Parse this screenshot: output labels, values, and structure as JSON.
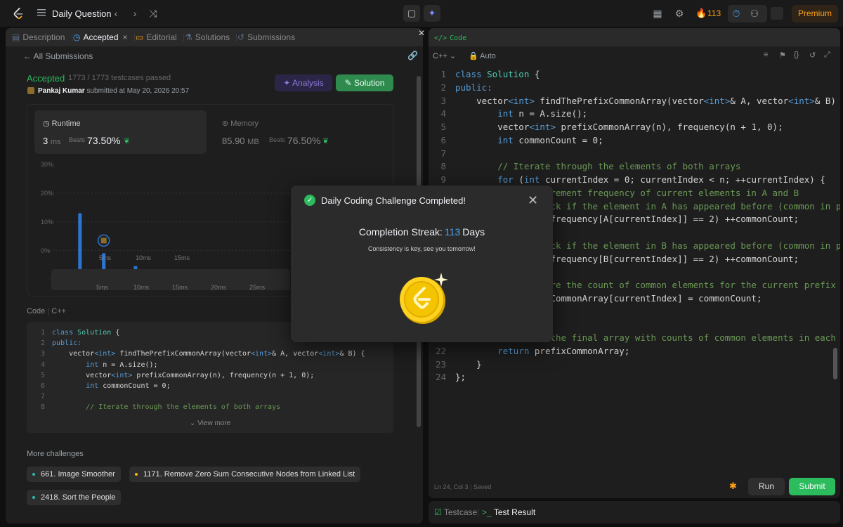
{
  "topbar": {
    "title": "Daily Question",
    "streak_count": "113",
    "premium_label": "Premium"
  },
  "left_tabs": [
    {
      "label": "Description"
    },
    {
      "label": "Accepted"
    },
    {
      "label": "Editorial"
    },
    {
      "label": "Solutions"
    },
    {
      "label": "Submissions"
    }
  ],
  "submission": {
    "back_label": "All Submissions",
    "status": "Accepted",
    "testcases": "1773 / 1773 testcases passed",
    "author": "Pankaj Kumar",
    "submitted_text": "submitted at May 20, 2026 20:57",
    "analysis_label": "Analysis",
    "solution_label": "Solution"
  },
  "stats": {
    "runtime_label": "Runtime",
    "runtime_value": "3",
    "runtime_unit": "ms",
    "runtime_beats_label": "Beats",
    "runtime_beats_pct": "73.50%",
    "memory_label": "Memory",
    "memory_value": "85.90",
    "memory_unit": "MB",
    "memory_beats_label": "Beats",
    "memory_beats_pct": "76.50%"
  },
  "chart_data": {
    "type": "bar",
    "y_ticks": [
      "30%",
      "20%",
      "10%",
      "0%"
    ],
    "x_ticks": [
      "5ms",
      "10ms",
      "15ms"
    ],
    "mini_x_ticks": [
      "5ms",
      "10ms",
      "15ms",
      "20ms",
      "25ms"
    ],
    "ylim": [
      0,
      30
    ],
    "values": [
      0.5,
      23,
      1.5,
      2,
      9,
      2,
      1.5,
      2,
      4.5,
      2,
      1.5,
      2.5,
      1.5,
      1,
      2,
      1.5,
      3,
      2.5,
      1.5,
      2,
      1.5,
      2.5,
      2,
      1.5,
      1.5,
      1.5
    ],
    "highlight_index": 4,
    "bar_color": "#2d74d3"
  },
  "left_code": {
    "header": "Code",
    "lang": "C++",
    "view_more": "View more"
  },
  "more_challenges": {
    "title": "More challenges",
    "items": [
      {
        "label": "661. Image Smoother",
        "color": "#2cbbac"
      },
      {
        "label": "1171. Remove Zero Sum Consecutive Nodes from Linked List",
        "color": "#ffb800"
      },
      {
        "label": "2418. Sort the People",
        "color": "#2cbbac"
      }
    ]
  },
  "editor": {
    "title": "Code",
    "language": "C++",
    "mode": "Auto",
    "status": "Ln 24, Col 3",
    "saved": "Saved",
    "run_label": "Run",
    "submit_label": "Submit"
  },
  "bottom_tabs": {
    "testcase": "Testcase",
    "test_result": "Test Result"
  },
  "modal": {
    "title": "Daily Coding Challenge Completed!",
    "streak_label": "Completion Streak:",
    "streak_num": "113",
    "streak_unit": "Days",
    "subtitle": "Consistency is key, see you tomorrow!"
  },
  "code_lines_left": [
    [
      {
        "t": "class ",
        "c": "kw"
      },
      {
        "t": "Solution ",
        "c": "ty"
      },
      {
        "t": "{",
        "c": "tx"
      }
    ],
    [
      {
        "t": "public:",
        "c": "kw"
      }
    ],
    [
      {
        "t": "    vector",
        "c": "tx"
      },
      {
        "t": "<int>",
        "c": "kw"
      },
      {
        "t": " findThePrefixCommonArray(vector",
        "c": "tx"
      },
      {
        "t": "<int>",
        "c": "kw"
      },
      {
        "t": "& A, vector",
        "c": "tx"
      },
      {
        "t": "<int>",
        "c": "kw"
      },
      {
        "t": "& B) {",
        "c": "tx"
      }
    ],
    [
      {
        "t": "        ",
        "c": "tx"
      },
      {
        "t": "int",
        "c": "kw"
      },
      {
        "t": " n = A.size();",
        "c": "tx"
      }
    ],
    [
      {
        "t": "        vector",
        "c": "tx"
      },
      {
        "t": "<int>",
        "c": "kw"
      },
      {
        "t": " prefixCommonArray(n), frequency(n + 1, 0);",
        "c": "tx"
      }
    ],
    [
      {
        "t": "        ",
        "c": "tx"
      },
      {
        "t": "int",
        "c": "kw"
      },
      {
        "t": " commonCount = 0;",
        "c": "tx"
      }
    ],
    [
      {
        "t": "",
        "c": "tx"
      }
    ],
    [
      {
        "t": "        // Iterate through the elements of both arrays",
        "c": "cm"
      }
    ]
  ],
  "code_lines_right": [
    [
      {
        "t": "class ",
        "c": "kw"
      },
      {
        "t": "Solution ",
        "c": "ty"
      },
      {
        "t": "{",
        "c": "tx"
      }
    ],
    [
      {
        "t": "public:",
        "c": "kw"
      }
    ],
    [
      {
        "t": "    vector",
        "c": "tx"
      },
      {
        "t": "<int>",
        "c": "kw"
      },
      {
        "t": " findThePrefixCommonArray(vector",
        "c": "tx"
      },
      {
        "t": "<int>",
        "c": "kw"
      },
      {
        "t": "& A, vector",
        "c": "tx"
      },
      {
        "t": "<int>",
        "c": "kw"
      },
      {
        "t": "& B) {",
        "c": "tx"
      }
    ],
    [
      {
        "t": "        ",
        "c": "tx"
      },
      {
        "t": "int",
        "c": "kw"
      },
      {
        "t": " n = A.size();",
        "c": "tx"
      }
    ],
    [
      {
        "t": "        vector",
        "c": "tx"
      },
      {
        "t": "<int>",
        "c": "kw"
      },
      {
        "t": " prefixCommonArray(n), frequency(n + 1, 0);",
        "c": "tx"
      }
    ],
    [
      {
        "t": "        ",
        "c": "tx"
      },
      {
        "t": "int",
        "c": "kw"
      },
      {
        "t": " commonCount = 0;",
        "c": "tx"
      }
    ],
    [
      {
        "t": "",
        "c": "tx"
      }
    ],
    [
      {
        "t": "        // Iterate through the elements of both arrays",
        "c": "cm"
      }
    ],
    [
      {
        "t": "        ",
        "c": "tx"
      },
      {
        "t": "for",
        "c": "kw"
      },
      {
        "t": " (",
        "c": "tx"
      },
      {
        "t": "int",
        "c": "kw"
      },
      {
        "t": " currentIndex = 0; currentIndex < n; ++currentIndex) {",
        "c": "tx"
      }
    ],
    [
      {
        "t": "            // Increment frequency of current elements in A and B",
        "c": "cm"
      }
    ],
    [
      {
        "t": "            // Check if the element in A has appeared before (common in prefix)",
        "c": "cm"
      }
    ],
    [
      {
        "t": "            ",
        "c": "tx"
      },
      {
        "t": "if",
        "c": "kw"
      },
      {
        "t": " (++frequency[A[currentIndex]] == 2) ++commonCount;",
        "c": "tx"
      }
    ],
    [
      {
        "t": "",
        "c": "tx"
      }
    ],
    [
      {
        "t": "            // Check if the element in B has appeared before (common in prefix)",
        "c": "cm"
      }
    ],
    [
      {
        "t": "            ",
        "c": "tx"
      },
      {
        "t": "if",
        "c": "kw"
      },
      {
        "t": " (++frequency[B[currentIndex]] == 2) ++commonCount;",
        "c": "tx"
      }
    ],
    [
      {
        "t": "",
        "c": "tx"
      }
    ],
    [
      {
        "t": "            // Store the count of common elements for the current prefix",
        "c": "cm"
      }
    ],
    [
      {
        "t": "            prefixCommonArray[currentIndex] = commonCount;",
        "c": "tx"
      }
    ],
    [
      {
        "t": "        }",
        "c": "tx"
      }
    ],
    [
      {
        "t": "",
        "c": "tx"
      }
    ],
    [
      {
        "t": "        // Return the final array with counts of common elements in each prefix",
        "c": "cm"
      }
    ],
    [
      {
        "t": "        ",
        "c": "tx"
      },
      {
        "t": "return",
        "c": "kw"
      },
      {
        "t": " prefixCommonArray;",
        "c": "tx"
      }
    ],
    [
      {
        "t": "    }",
        "c": "tx"
      }
    ],
    [
      {
        "t": "};",
        "c": "tx"
      }
    ]
  ]
}
